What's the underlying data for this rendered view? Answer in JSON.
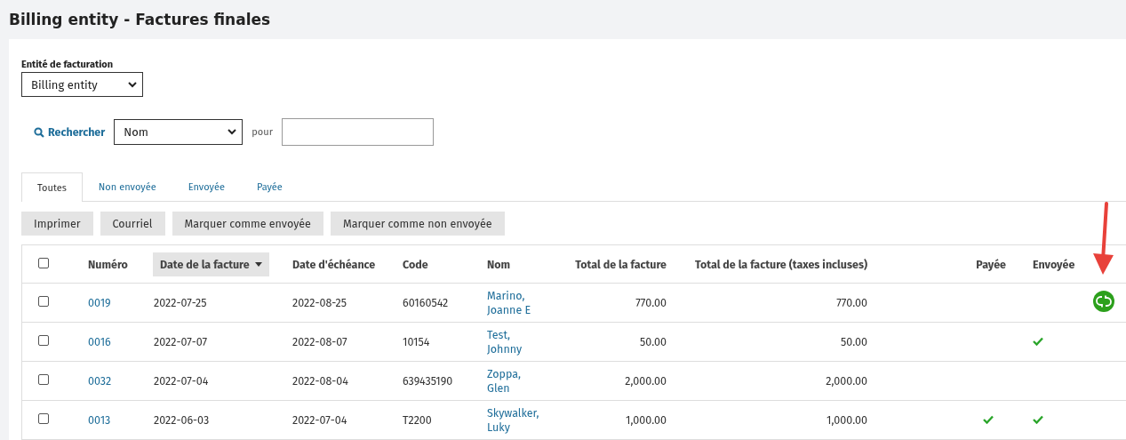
{
  "page_title": "Billing entity - Factures finales",
  "billing_entity": {
    "label": "Entité de facturation",
    "value": "Billing entity"
  },
  "search": {
    "label": "Rechercher",
    "field": "Nom",
    "connector": "pour"
  },
  "tabs": [
    {
      "label": "Toutes",
      "selected": true
    },
    {
      "label": "Non envoyée",
      "selected": false
    },
    {
      "label": "Envoyée",
      "selected": false
    },
    {
      "label": "Payée",
      "selected": false
    }
  ],
  "actions": [
    "Imprimer",
    "Courriel",
    "Marquer comme envoyée",
    "Marquer comme non envoyée"
  ],
  "table": {
    "columns": [
      {
        "label": "Numéro",
        "sorted": false
      },
      {
        "label": "Date de la facture",
        "sorted": true
      },
      {
        "label": "Date d'échéance",
        "sorted": false
      },
      {
        "label": "Code",
        "sorted": false
      },
      {
        "label": "Nom",
        "sorted": false
      },
      {
        "label": "Total de la facture",
        "sorted": false
      },
      {
        "label": "Total de la facture (taxes incluses)",
        "sorted": false
      },
      {
        "label": "Payée",
        "sorted": false
      },
      {
        "label": "Envoyée",
        "sorted": false
      }
    ],
    "all_checked": false,
    "rows": [
      {
        "checked": false,
        "number": "0019",
        "date": "2022-07-25",
        "due": "2022-08-25",
        "code": "60160542",
        "name": "Marino, Joanne E",
        "total": "770.00",
        "total_tax": "770.00",
        "paid": false,
        "sent": false,
        "synced": true
      },
      {
        "checked": false,
        "number": "0016",
        "date": "2022-07-07",
        "due": "2022-08-07",
        "code": "10154",
        "name": "Test, Johnny",
        "total": "50.00",
        "total_tax": "50.00",
        "paid": false,
        "sent": true,
        "synced": false
      },
      {
        "checked": false,
        "number": "0032",
        "date": "2022-07-04",
        "due": "2022-08-04",
        "code": "639435190",
        "name": "Zoppa, Glen",
        "total": "2,000.00",
        "total_tax": "2,000.00",
        "paid": false,
        "sent": false,
        "synced": false
      },
      {
        "checked": false,
        "number": "0013",
        "date": "2022-06-03",
        "due": "2022-07-04",
        "code": "T2200",
        "name": "Skywalker, Luky",
        "total": "1,000.00",
        "total_tax": "1,000.00",
        "paid": true,
        "sent": true,
        "synced": false
      }
    ]
  }
}
